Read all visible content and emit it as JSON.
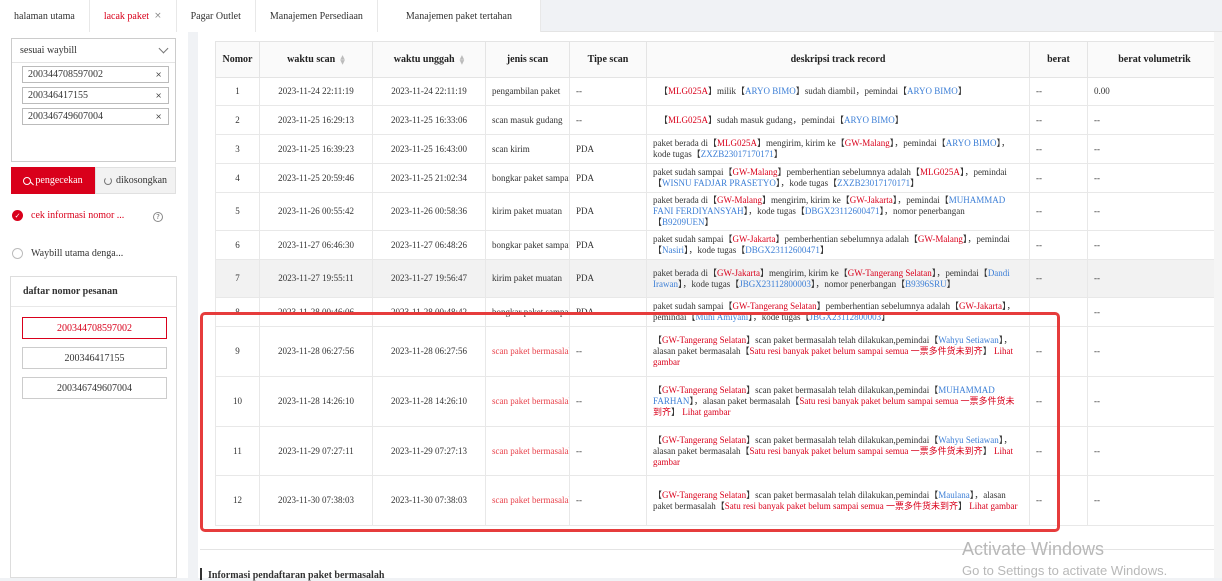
{
  "tabs": [
    {
      "label": "halaman utama"
    },
    {
      "label": "lacak paket"
    },
    {
      "label": "Pagar Outlet"
    },
    {
      "label": "Manajemen Persediaan"
    },
    {
      "label": "Manajemen paket tertahan"
    }
  ],
  "left": {
    "select_value": "sesuai waybill",
    "waybills": [
      "200344708597002",
      "200346417155",
      "200346749607004"
    ],
    "search_btn": "pengecekan",
    "reset_btn": "dikosongkan",
    "option1": "cek informasi nomor ...",
    "option2": "Waybill utama denga...",
    "list_title": "daftar nomor pesanan",
    "list": [
      "200344708597002",
      "200346417155",
      "200346749607004"
    ]
  },
  "table": {
    "headers": [
      "Nomor",
      "waktu scan",
      "waktu unggah",
      "jenis scan",
      "Tipe scan",
      "deskripsi track record",
      "berat",
      "berat volumetrik"
    ],
    "rows": [
      {
        "no": "1",
        "scan": "2023-11-24 22:11:19",
        "upload": "2023-11-24 22:11:19",
        "jenis": "pengambilan paket",
        "tipe": "--",
        "berat": "--",
        "vol": "0.00"
      },
      {
        "no": "2",
        "scan": "2023-11-25 16:29:13",
        "upload": "2023-11-25 16:33:06",
        "jenis": "scan masuk gudang",
        "tipe": "--",
        "berat": "--",
        "vol": "--"
      },
      {
        "no": "3",
        "scan": "2023-11-25 16:39:23",
        "upload": "2023-11-25 16:43:00",
        "jenis": "scan kirim",
        "tipe": "PDA",
        "berat": "--",
        "vol": "--"
      },
      {
        "no": "4",
        "scan": "2023-11-25 20:59:46",
        "upload": "2023-11-25 21:02:34",
        "jenis": "bongkar paket sampai",
        "tipe": "PDA",
        "berat": "--",
        "vol": "--"
      },
      {
        "no": "5",
        "scan": "2023-11-26 00:55:42",
        "upload": "2023-11-26 00:58:36",
        "jenis": "kirim paket muatan",
        "tipe": "PDA",
        "berat": "--",
        "vol": "--"
      },
      {
        "no": "6",
        "scan": "2023-11-27 06:46:30",
        "upload": "2023-11-27 06:48:26",
        "jenis": "bongkar paket sampai",
        "tipe": "PDA",
        "berat": "--",
        "vol": "--"
      },
      {
        "no": "7",
        "scan": "2023-11-27 19:55:11",
        "upload": "2023-11-27 19:56:47",
        "jenis": "kirim paket muatan",
        "tipe": "PDA",
        "berat": "--",
        "vol": "--"
      },
      {
        "no": "8",
        "scan": "2023-11-28 00:46:06",
        "upload": "2023-11-28 00:48:42",
        "jenis": "bongkar paket sampai",
        "tipe": "PDA",
        "berat": "--",
        "vol": "--"
      },
      {
        "no": "9",
        "scan": "2023-11-28 06:27:56",
        "upload": "2023-11-28 06:27:56",
        "jenis": "scan paket bermasalah",
        "tipe": "--",
        "berat": "--",
        "vol": "--"
      },
      {
        "no": "10",
        "scan": "2023-11-28 14:26:10",
        "upload": "2023-11-28 14:26:10",
        "jenis": "scan paket bermasalah",
        "tipe": "--",
        "berat": "--",
        "vol": "--"
      },
      {
        "no": "11",
        "scan": "2023-11-29 07:27:11",
        "upload": "2023-11-29 07:27:13",
        "jenis": "scan paket bermasalah",
        "tipe": "--",
        "berat": "--",
        "vol": "--"
      },
      {
        "no": "12",
        "scan": "2023-11-30 07:38:03",
        "upload": "2023-11-30 07:38:03",
        "jenis": "scan paket bermasalah",
        "tipe": "--",
        "berat": "--",
        "vol": "--"
      }
    ],
    "desc": {
      "r1": [
        "【",
        "MLG025A",
        "】milik【",
        "ARYO BIMO",
        "】sudah diambil，pemindai【",
        "ARYO BIMO",
        "】"
      ],
      "r2": [
        "【",
        "MLG025A",
        "】sudah masuk gudang，pemindai【",
        "ARYO BIMO",
        "】"
      ],
      "r3": [
        "paket berada di【",
        "MLG025A",
        "】mengirim, kirim ke【",
        "GW-Malang",
        "】，pemindai【",
        "ARYO BIMO",
        "】，kode tugas【",
        "ZXZB23017170171",
        "】"
      ],
      "r4": [
        "paket sudah sampai【",
        "GW-Malang",
        "】pemberhentian sebelumnya adalah【",
        "MLG025A",
        "】，pemindai【",
        "WISNU FADJAR PRASETYO",
        "】，kode tugas【",
        "ZXZB23017170171",
        "】"
      ],
      "r5": [
        "paket berada di【",
        "GW-Malang",
        "】mengirim, kirim ke【",
        "GW-Jakarta",
        "】，pemindai【",
        "MUHAMMAD FANI FERDIYANSYAH",
        "】，kode tugas【",
        "DBGX23112600471",
        "】，nomor penerbangan【",
        "B9209UEN",
        "】"
      ],
      "r6": [
        "paket sudah sampai【",
        "GW-Jakarta",
        "】pemberhentian sebelumnya adalah【",
        "GW-Malang",
        "】，pemindai【",
        "Nasiri",
        "】，kode tugas【",
        "DBGX23112600471",
        "】"
      ],
      "r7": [
        "paket berada di【",
        "GW-Jakarta",
        "】mengirim, kirim ke【",
        "GW-Tangerang Selatan",
        "】，pemindai【",
        "Dandi Irawan",
        "】，kode tugas【",
        "JBGX23112800003",
        "】，nomor penerbangan【",
        "B9396SRU",
        "】"
      ],
      "r8": [
        "paket sudah sampai【",
        "GW-Tangerang Selatan",
        "】pemberhentian sebelumnya adalah【",
        "GW-Jakarta",
        "】，pemindai【",
        "Muhi Amiyani",
        "】，kode tugas【",
        "JBGX23112800003",
        "】"
      ],
      "r9": [
        "【",
        "GW-Tangerang Selatan",
        "】scan paket bermasalah telah dilakukan,pemindai【",
        "Wahyu Setiawan",
        "】，alasan paket bermasalah【",
        "Satu resi banyak paket belum sampai semua 一票多件货未到齐",
        "】",
        "Lihat gambar"
      ],
      "r10": [
        "【",
        "GW-Tangerang Selatan",
        "】scan paket bermasalah telah dilakukan,pemindai【",
        "MUHAMMAD FARHAN",
        "】，alasan paket bermasalah【",
        "Satu resi banyak paket belum sampai semua 一票多件货未到齐",
        "】",
        "Lihat gambar"
      ],
      "r11": [
        "【",
        "GW-Tangerang Selatan",
        "】scan paket bermasalah telah dilakukan,pemindai【",
        "Wahyu Setiawan",
        "】，alasan paket bermasalah【",
        "Satu resi banyak paket belum sampai semua 一票多件货未到齐",
        "】",
        "Lihat gambar"
      ],
      "r12": [
        "【",
        "GW-Tangerang Selatan",
        "】scan paket bermasalah telah dilakukan,pemindai【",
        "Maulana",
        "】，alasan paket bermasalah【",
        "Satu resi banyak paket belum sampai semua 一票多件货未到齐",
        "】",
        "Lihat gambar"
      ]
    }
  },
  "bottom_title": "Informasi pendaftaran paket bermasalah",
  "watermark": {
    "line1": "Activate Windows",
    "line2": "Go to Settings to activate Windows."
  }
}
